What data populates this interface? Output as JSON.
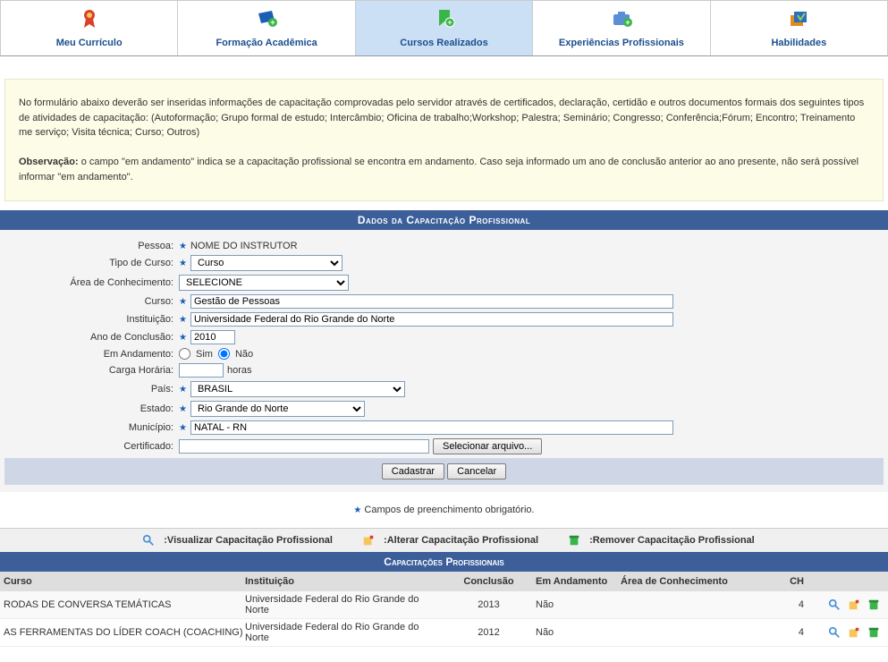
{
  "tabs": [
    {
      "label": "Meu Currículo",
      "icon": "ribbon",
      "color": "#d9412a"
    },
    {
      "label": "Formação Acadêmica",
      "icon": "book",
      "color": "#1a5fb4"
    },
    {
      "label": "Cursos Realizados",
      "icon": "bookmark",
      "color": "#3ab54a"
    },
    {
      "label": "Experiências Profissionais",
      "icon": "briefcase",
      "color": "#5a8fd8"
    },
    {
      "label": "Habilidades",
      "icon": "skills",
      "color": "#e28b1f"
    }
  ],
  "info": {
    "p1": "No formulário abaixo deverão ser inseridas informações de capacitação comprovadas pelo servidor através de certificados, declaração, certidão e outros documentos formais dos seguintes tipos de atividades de capacitação: (Autoformação; Grupo formal de estudo; Intercâmbio; Oficina de trabalho;Workshop; Palestra; Seminário; Congresso; Conferência;Fórum; Encontro; Treinamento me serviço; Visita técnica; Curso; Outros)",
    "obs_label": "Observação:",
    "obs_text": " o campo \"em andamento\" indica se a capacitação profissional se encontra em andamento. Caso seja informado um ano de conclusão anterior ao ano presente, não será possível informar \"em andamento\"."
  },
  "section_title": "Dados da Capacitação Profissional",
  "form": {
    "pessoa_label": "Pessoa:",
    "pessoa_value": "NOME DO INSTRUTOR",
    "tipo_label": "Tipo de Curso:",
    "tipo_value": "Curso",
    "area_label": "Área de Conhecimento:",
    "area_value": "SELECIONE",
    "curso_label": "Curso:",
    "curso_value": "Gestão de Pessoas",
    "inst_label": "Instituição:",
    "inst_value": "Universidade Federal do Rio Grande do Norte",
    "ano_label": "Ano de Conclusão:",
    "ano_value": "2010",
    "and_label": "Em Andamento:",
    "and_sim": "Sim",
    "and_nao": "Não",
    "ch_label": "Carga Horária:",
    "ch_value": "",
    "ch_unit": "horas",
    "pais_label": "País:",
    "pais_value": "BRASIL",
    "estado_label": "Estado:",
    "estado_value": "Rio Grande do Norte",
    "mun_label": "Município:",
    "mun_value": "NATAL - RN",
    "cert_label": "Certificado:",
    "cert_btn": "Selecionar arquivo...",
    "cadastrar": "Cadastrar",
    "cancelar": "Cancelar"
  },
  "caption": "Campos de preenchimento obrigatório.",
  "legend": {
    "view": ":Visualizar Capacitação Profissional",
    "edit": ":Alterar Capacitação Profissional",
    "del": ":Remover Capacitação Profissional"
  },
  "table_title": "Capacitações Profissionais",
  "columns": {
    "curso": "Curso",
    "inst": "Instituição",
    "concl": "Conclusão",
    "and": "Em Andamento",
    "area": "Área de Conhecimento",
    "ch": "CH"
  },
  "rows": [
    {
      "curso": "RODAS DE CONVERSA TEMÁTICAS",
      "inst": "Universidade Federal do Rio Grande do Norte",
      "concl": "2013",
      "and": "Não",
      "area": "",
      "ch": "4"
    },
    {
      "curso": "AS FERRAMENTAS DO LÍDER COACH (COACHING)",
      "inst": "Universidade Federal do Rio Grande do Norte",
      "concl": "2012",
      "and": "Não",
      "area": "",
      "ch": "4"
    }
  ]
}
